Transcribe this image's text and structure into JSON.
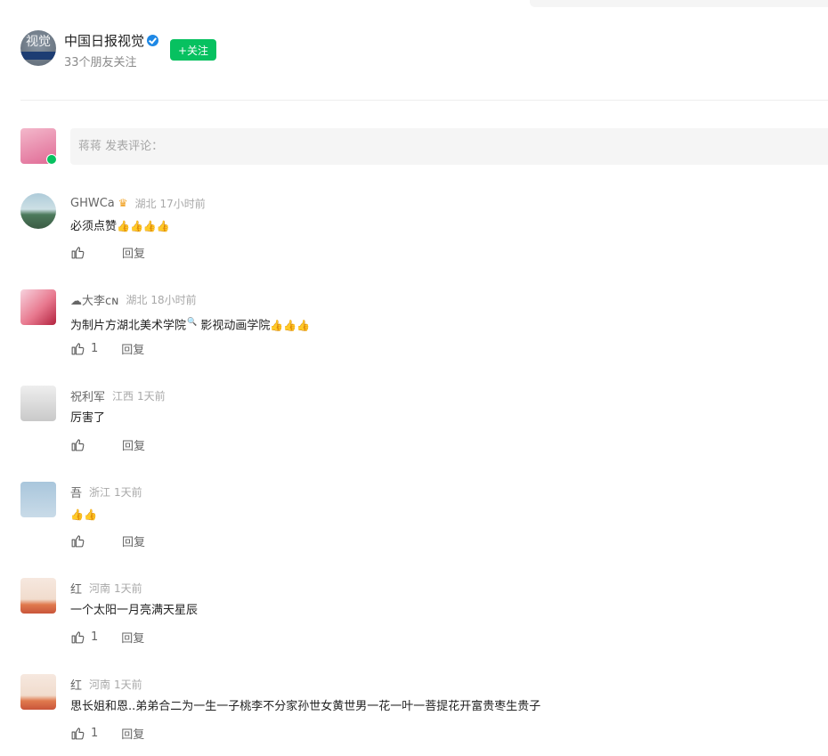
{
  "account": {
    "name": "中国日报视觉",
    "followers": "33个朋友关注",
    "follow_label": "+关注",
    "avatar_text": "视觉"
  },
  "comment_box": {
    "placeholder": "蒋蒋 发表评论："
  },
  "colors": {
    "accent_green": "#07c160",
    "verified_blue": "#1e88e5",
    "link_blue": "#576b95"
  },
  "comments": [
    {
      "user": "GHWCa",
      "badge": "♛",
      "location": "湖北",
      "time": "17小时前",
      "text": "必须点赞",
      "emoji": "👍👍👍👍",
      "likes": "",
      "reply": "回复"
    },
    {
      "user": "☁大李ᴄɴ",
      "location": "湖北",
      "time": "18小时前",
      "text_part1": "为制片方湖北美术学院",
      "link_mark": "🔍",
      "text_part2": "  影视动画学院",
      "emoji": "👍👍👍",
      "likes": "1",
      "reply": "回复"
    },
    {
      "user": "祝利军",
      "location": "江西",
      "time": "1天前",
      "text": "厉害了",
      "likes": "",
      "reply": "回复"
    },
    {
      "user": "吾",
      "location": "浙江",
      "time": "1天前",
      "emoji": "👍👍",
      "likes": "",
      "reply": "回复"
    },
    {
      "user": "红",
      "location": "河南",
      "time": "1天前",
      "text": "一个太阳一月亮满天星辰",
      "likes": "1",
      "reply": "回复"
    },
    {
      "user": "红",
      "location": "河南",
      "time": "1天前",
      "text": "思长姐和恩..弟弟合二为一生一子桃李不分家孙世女黄世男一花一叶一菩提花开富贵枣生贵子",
      "likes": "1",
      "reply": "回复"
    }
  ]
}
